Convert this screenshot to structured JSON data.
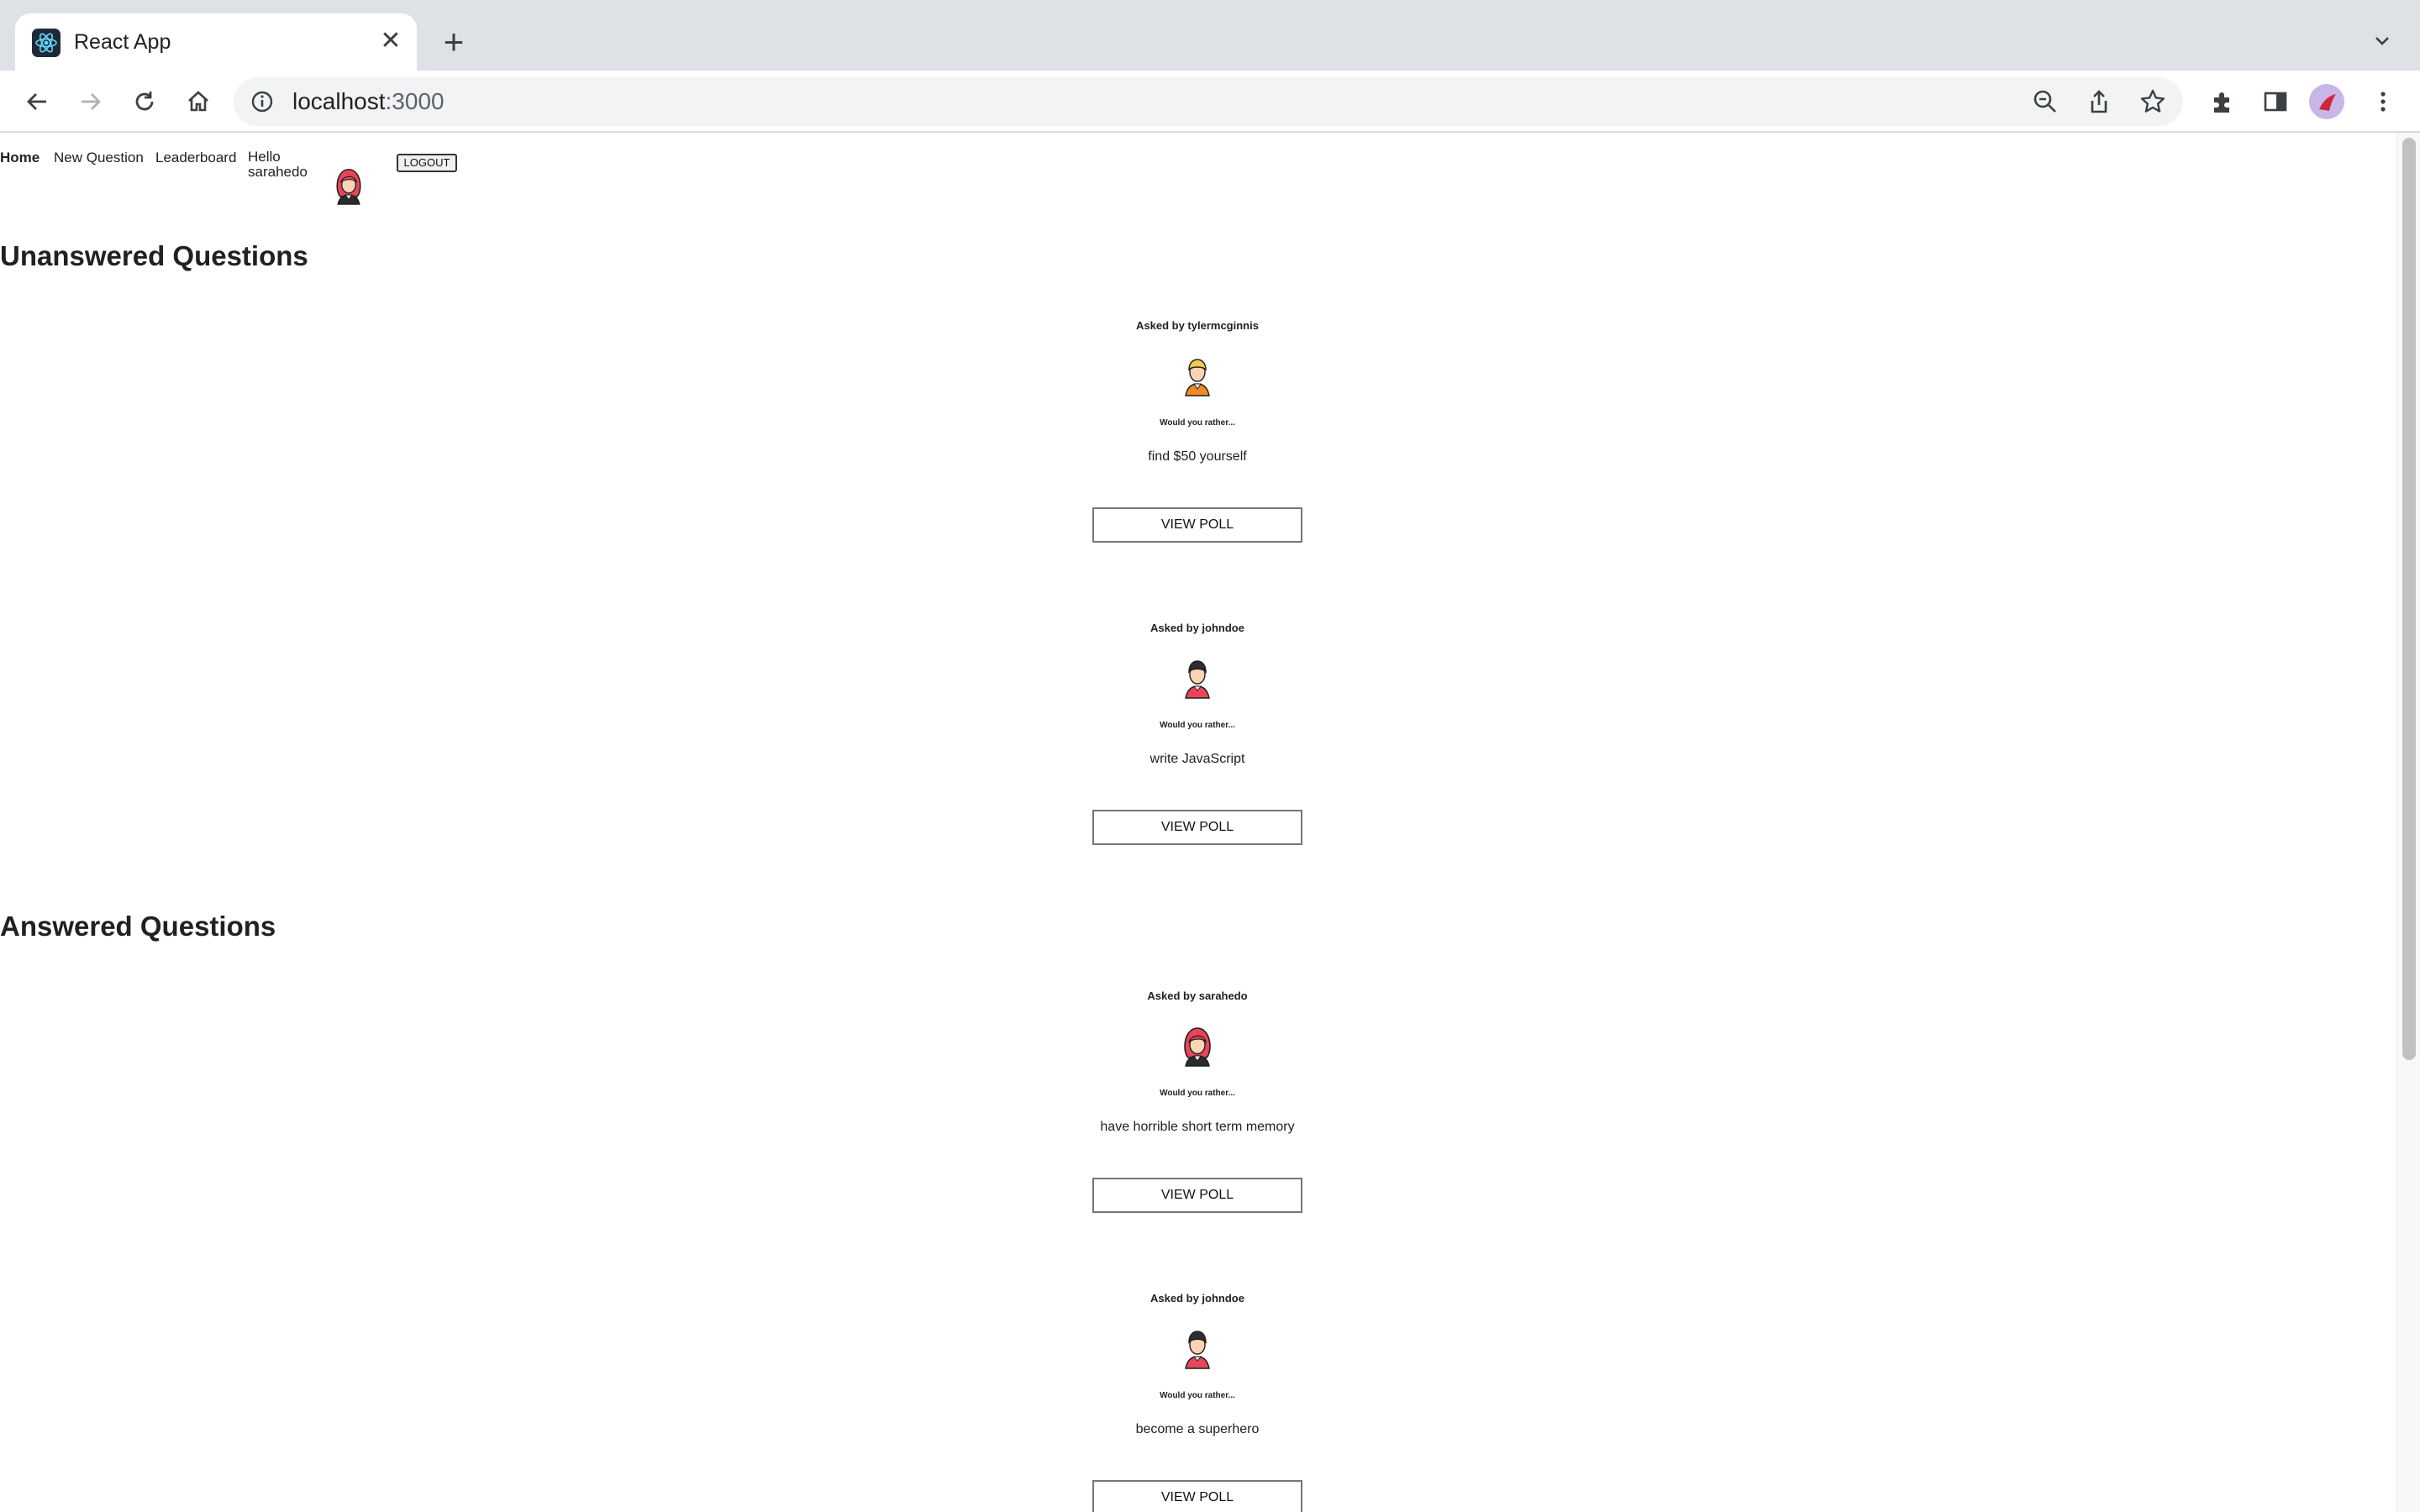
{
  "browser": {
    "tab_title": "React App",
    "url_host": "localhost",
    "url_port": ":3000"
  },
  "nav": {
    "home": "Home",
    "new_question": "New Question",
    "leaderboard": "Leaderboard",
    "hello_line1": "Hello",
    "hello_line2": "sarahedo",
    "logout": "LOGOUT"
  },
  "sections": {
    "unanswered_title": "Unanswered Questions",
    "answered_title": "Answered Questions"
  },
  "unanswered": [
    {
      "asked_by": "Asked by tylermcginnis",
      "avatar": "blonde-man-avatar-icon",
      "prompt": "Would you rather...",
      "option": "find $50 yourself",
      "button": "VIEW POLL"
    },
    {
      "asked_by": "Asked by johndoe",
      "avatar": "dark-hair-man-avatar-icon",
      "prompt": "Would you rather...",
      "option": "write JavaScript",
      "button": "VIEW POLL"
    }
  ],
  "answered": [
    {
      "asked_by": "Asked by sarahedo",
      "avatar": "red-hair-woman-avatar-icon",
      "prompt": "Would you rather...",
      "option": "have horrible short term memory",
      "button": "VIEW POLL"
    },
    {
      "asked_by": "Asked by johndoe",
      "avatar": "dark-hair-man-avatar-icon",
      "prompt": "Would you rather...",
      "option": "become a superhero",
      "button": "VIEW POLL"
    }
  ]
}
